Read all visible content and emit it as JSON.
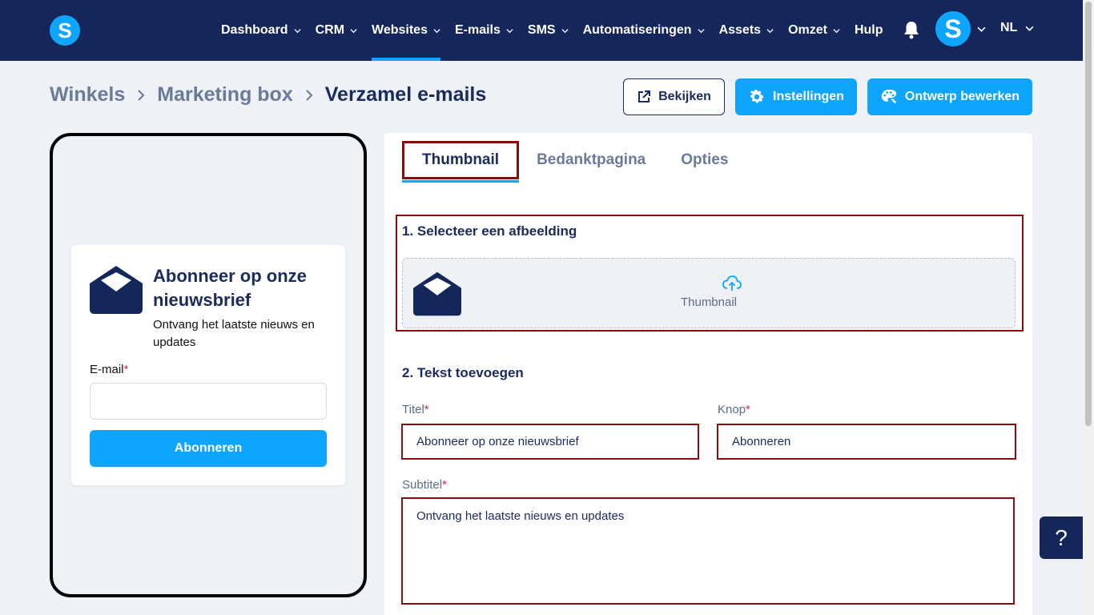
{
  "brand": {
    "logo_letter": "S",
    "accent": "#0ea5ff",
    "navy": "#14265a"
  },
  "nav": {
    "items": [
      {
        "label": "Dashboard",
        "has_menu": true
      },
      {
        "label": "CRM",
        "has_menu": true
      },
      {
        "label": "Websites",
        "has_menu": true,
        "active": true
      },
      {
        "label": "E-mails",
        "has_menu": true
      },
      {
        "label": "SMS",
        "has_menu": true
      },
      {
        "label": "Automatiseringen",
        "has_menu": true
      },
      {
        "label": "Assets",
        "has_menu": true
      },
      {
        "label": "Omzet",
        "has_menu": true
      },
      {
        "label": "Hulp",
        "has_menu": false
      }
    ],
    "avatar_letter": "S",
    "language": "NL"
  },
  "breadcrumb": [
    "Winkels",
    "Marketing box",
    "Verzamel e-mails"
  ],
  "actions": {
    "view": "Bekijken",
    "settings": "Instellingen",
    "edit_design": "Ontwerp bewerken"
  },
  "preview": {
    "title": "Abonneer op onze nieuwsbrief",
    "subtitle": "Ontvang het laatste nieuws en updates",
    "email_label": "E-mail",
    "required_mark": "*",
    "button": "Abonneren"
  },
  "editor": {
    "tabs": [
      "Thumbnail",
      "Bedanktpagina",
      "Opties"
    ],
    "active_tab": "Thumbnail",
    "section_image": "1. Selecteer een afbeelding",
    "upload_label": "Thumbnail",
    "section_text": "2. Tekst toevoegen",
    "fields": {
      "title_label": "Titel",
      "title_value": "Abonneer op onze nieuwsbrief",
      "button_label": "Knop",
      "button_value": "Abonneren",
      "subtitle_label": "Subtitel",
      "subtitle_value": "Ontvang het laatste nieuws en updates"
    }
  },
  "help_label": "?"
}
